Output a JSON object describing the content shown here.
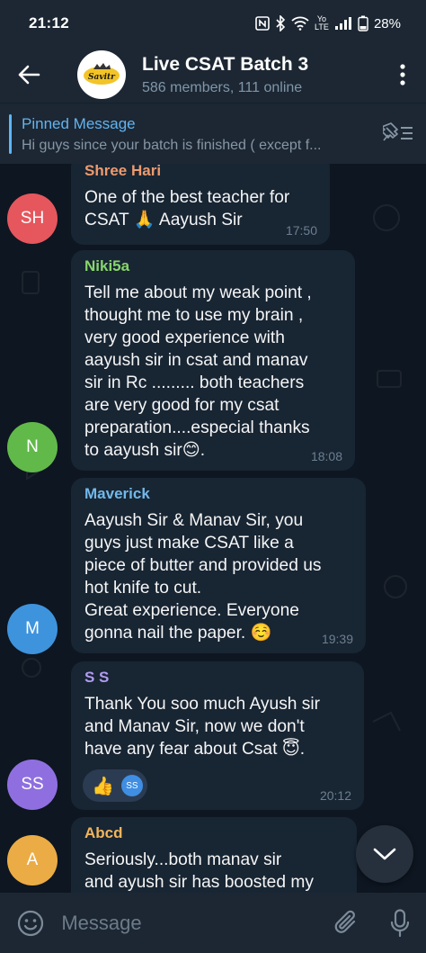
{
  "status": {
    "time": "21:12",
    "network": "Yo LTE",
    "battery": "28%",
    "icons": [
      "nfc-icon",
      "bluetooth-icon",
      "wifi-icon",
      "signal-icon",
      "battery-icon"
    ]
  },
  "header": {
    "title": "Live CSAT Batch 3",
    "subtitle": "586 members, 111 online",
    "avatar_icon": "group-logo-icon"
  },
  "pinned": {
    "title": "Pinned Message",
    "text": "Hi guys since your batch is finished ( except f..."
  },
  "messages": [
    {
      "sender": "Shree Hari",
      "text": "One of the best teacher for\nCSAT 🙏 Aayush Sir",
      "time": "17:50",
      "initials": "SH",
      "sender_color": "#ee9a6e",
      "avatar_color": "#e5575d"
    },
    {
      "sender": "Niki5a",
      "text": "Tell me about my weak point ,\nthought me to use my brain ,\nvery good experience with\naayush sir in csat and manav\nsir in Rc ......... both teachers\nare very good for my csat\npreparation....especial thanks\nto aayush sir😊.",
      "time": "18:08",
      "initials": "N",
      "sender_color": "#87d56c",
      "avatar_color": "#61b94a"
    },
    {
      "sender": "Maverick",
      "text": "Aayush Sir & Manav Sir, you\nguys just make CSAT like a\npiece of butter and provided us\nhot knife to cut.\nGreat experience. Everyone\ngonna nail the paper. ☺️",
      "time": "19:39",
      "initials": "M",
      "sender_color": "#72b8ea",
      "avatar_color": "#3e93dd"
    },
    {
      "sender": "S S",
      "text": "Thank You soo much Ayush sir\nand Manav Sir, now we don't\nhave any fear about Csat 😇.",
      "time": "20:12",
      "initials": "SS",
      "sender_color": "#b19cf0",
      "avatar_color": "#8f6fe0",
      "reaction": {
        "emoji": "👍",
        "user_initials": "SS"
      }
    },
    {
      "sender": "Abcd",
      "text": "Seriously...both manav sir\nand ayush sir has boosted my",
      "time": "",
      "initials": "A",
      "sender_color": "#f1b55b",
      "avatar_color": "#ebac45"
    }
  ],
  "input": {
    "placeholder": "Message"
  }
}
